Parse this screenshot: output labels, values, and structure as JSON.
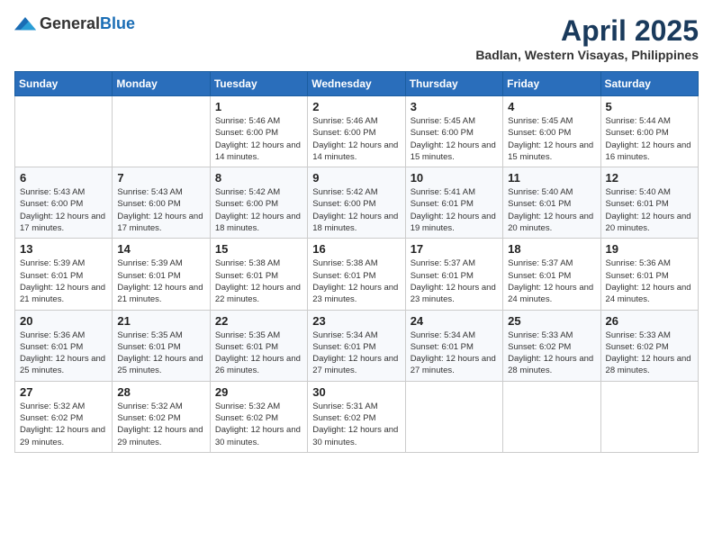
{
  "logo": {
    "general": "General",
    "blue": "Blue"
  },
  "header": {
    "title": "April 2025",
    "subtitle": "Badlan, Western Visayas, Philippines"
  },
  "weekdays": [
    "Sunday",
    "Monday",
    "Tuesday",
    "Wednesday",
    "Thursday",
    "Friday",
    "Saturday"
  ],
  "weeks": [
    [
      {
        "day": "",
        "sunrise": "",
        "sunset": "",
        "daylight": ""
      },
      {
        "day": "",
        "sunrise": "",
        "sunset": "",
        "daylight": ""
      },
      {
        "day": "1",
        "sunrise": "Sunrise: 5:46 AM",
        "sunset": "Sunset: 6:00 PM",
        "daylight": "Daylight: 12 hours and 14 minutes."
      },
      {
        "day": "2",
        "sunrise": "Sunrise: 5:46 AM",
        "sunset": "Sunset: 6:00 PM",
        "daylight": "Daylight: 12 hours and 14 minutes."
      },
      {
        "day": "3",
        "sunrise": "Sunrise: 5:45 AM",
        "sunset": "Sunset: 6:00 PM",
        "daylight": "Daylight: 12 hours and 15 minutes."
      },
      {
        "day": "4",
        "sunrise": "Sunrise: 5:45 AM",
        "sunset": "Sunset: 6:00 PM",
        "daylight": "Daylight: 12 hours and 15 minutes."
      },
      {
        "day": "5",
        "sunrise": "Sunrise: 5:44 AM",
        "sunset": "Sunset: 6:00 PM",
        "daylight": "Daylight: 12 hours and 16 minutes."
      }
    ],
    [
      {
        "day": "6",
        "sunrise": "Sunrise: 5:43 AM",
        "sunset": "Sunset: 6:00 PM",
        "daylight": "Daylight: 12 hours and 17 minutes."
      },
      {
        "day": "7",
        "sunrise": "Sunrise: 5:43 AM",
        "sunset": "Sunset: 6:00 PM",
        "daylight": "Daylight: 12 hours and 17 minutes."
      },
      {
        "day": "8",
        "sunrise": "Sunrise: 5:42 AM",
        "sunset": "Sunset: 6:00 PM",
        "daylight": "Daylight: 12 hours and 18 minutes."
      },
      {
        "day": "9",
        "sunrise": "Sunrise: 5:42 AM",
        "sunset": "Sunset: 6:00 PM",
        "daylight": "Daylight: 12 hours and 18 minutes."
      },
      {
        "day": "10",
        "sunrise": "Sunrise: 5:41 AM",
        "sunset": "Sunset: 6:01 PM",
        "daylight": "Daylight: 12 hours and 19 minutes."
      },
      {
        "day": "11",
        "sunrise": "Sunrise: 5:40 AM",
        "sunset": "Sunset: 6:01 PM",
        "daylight": "Daylight: 12 hours and 20 minutes."
      },
      {
        "day": "12",
        "sunrise": "Sunrise: 5:40 AM",
        "sunset": "Sunset: 6:01 PM",
        "daylight": "Daylight: 12 hours and 20 minutes."
      }
    ],
    [
      {
        "day": "13",
        "sunrise": "Sunrise: 5:39 AM",
        "sunset": "Sunset: 6:01 PM",
        "daylight": "Daylight: 12 hours and 21 minutes."
      },
      {
        "day": "14",
        "sunrise": "Sunrise: 5:39 AM",
        "sunset": "Sunset: 6:01 PM",
        "daylight": "Daylight: 12 hours and 21 minutes."
      },
      {
        "day": "15",
        "sunrise": "Sunrise: 5:38 AM",
        "sunset": "Sunset: 6:01 PM",
        "daylight": "Daylight: 12 hours and 22 minutes."
      },
      {
        "day": "16",
        "sunrise": "Sunrise: 5:38 AM",
        "sunset": "Sunset: 6:01 PM",
        "daylight": "Daylight: 12 hours and 23 minutes."
      },
      {
        "day": "17",
        "sunrise": "Sunrise: 5:37 AM",
        "sunset": "Sunset: 6:01 PM",
        "daylight": "Daylight: 12 hours and 23 minutes."
      },
      {
        "day": "18",
        "sunrise": "Sunrise: 5:37 AM",
        "sunset": "Sunset: 6:01 PM",
        "daylight": "Daylight: 12 hours and 24 minutes."
      },
      {
        "day": "19",
        "sunrise": "Sunrise: 5:36 AM",
        "sunset": "Sunset: 6:01 PM",
        "daylight": "Daylight: 12 hours and 24 minutes."
      }
    ],
    [
      {
        "day": "20",
        "sunrise": "Sunrise: 5:36 AM",
        "sunset": "Sunset: 6:01 PM",
        "daylight": "Daylight: 12 hours and 25 minutes."
      },
      {
        "day": "21",
        "sunrise": "Sunrise: 5:35 AM",
        "sunset": "Sunset: 6:01 PM",
        "daylight": "Daylight: 12 hours and 25 minutes."
      },
      {
        "day": "22",
        "sunrise": "Sunrise: 5:35 AM",
        "sunset": "Sunset: 6:01 PM",
        "daylight": "Daylight: 12 hours and 26 minutes."
      },
      {
        "day": "23",
        "sunrise": "Sunrise: 5:34 AM",
        "sunset": "Sunset: 6:01 PM",
        "daylight": "Daylight: 12 hours and 27 minutes."
      },
      {
        "day": "24",
        "sunrise": "Sunrise: 5:34 AM",
        "sunset": "Sunset: 6:01 PM",
        "daylight": "Daylight: 12 hours and 27 minutes."
      },
      {
        "day": "25",
        "sunrise": "Sunrise: 5:33 AM",
        "sunset": "Sunset: 6:02 PM",
        "daylight": "Daylight: 12 hours and 28 minutes."
      },
      {
        "day": "26",
        "sunrise": "Sunrise: 5:33 AM",
        "sunset": "Sunset: 6:02 PM",
        "daylight": "Daylight: 12 hours and 28 minutes."
      }
    ],
    [
      {
        "day": "27",
        "sunrise": "Sunrise: 5:32 AM",
        "sunset": "Sunset: 6:02 PM",
        "daylight": "Daylight: 12 hours and 29 minutes."
      },
      {
        "day": "28",
        "sunrise": "Sunrise: 5:32 AM",
        "sunset": "Sunset: 6:02 PM",
        "daylight": "Daylight: 12 hours and 29 minutes."
      },
      {
        "day": "29",
        "sunrise": "Sunrise: 5:32 AM",
        "sunset": "Sunset: 6:02 PM",
        "daylight": "Daylight: 12 hours and 30 minutes."
      },
      {
        "day": "30",
        "sunrise": "Sunrise: 5:31 AM",
        "sunset": "Sunset: 6:02 PM",
        "daylight": "Daylight: 12 hours and 30 minutes."
      },
      {
        "day": "",
        "sunrise": "",
        "sunset": "",
        "daylight": ""
      },
      {
        "day": "",
        "sunrise": "",
        "sunset": "",
        "daylight": ""
      },
      {
        "day": "",
        "sunrise": "",
        "sunset": "",
        "daylight": ""
      }
    ]
  ]
}
